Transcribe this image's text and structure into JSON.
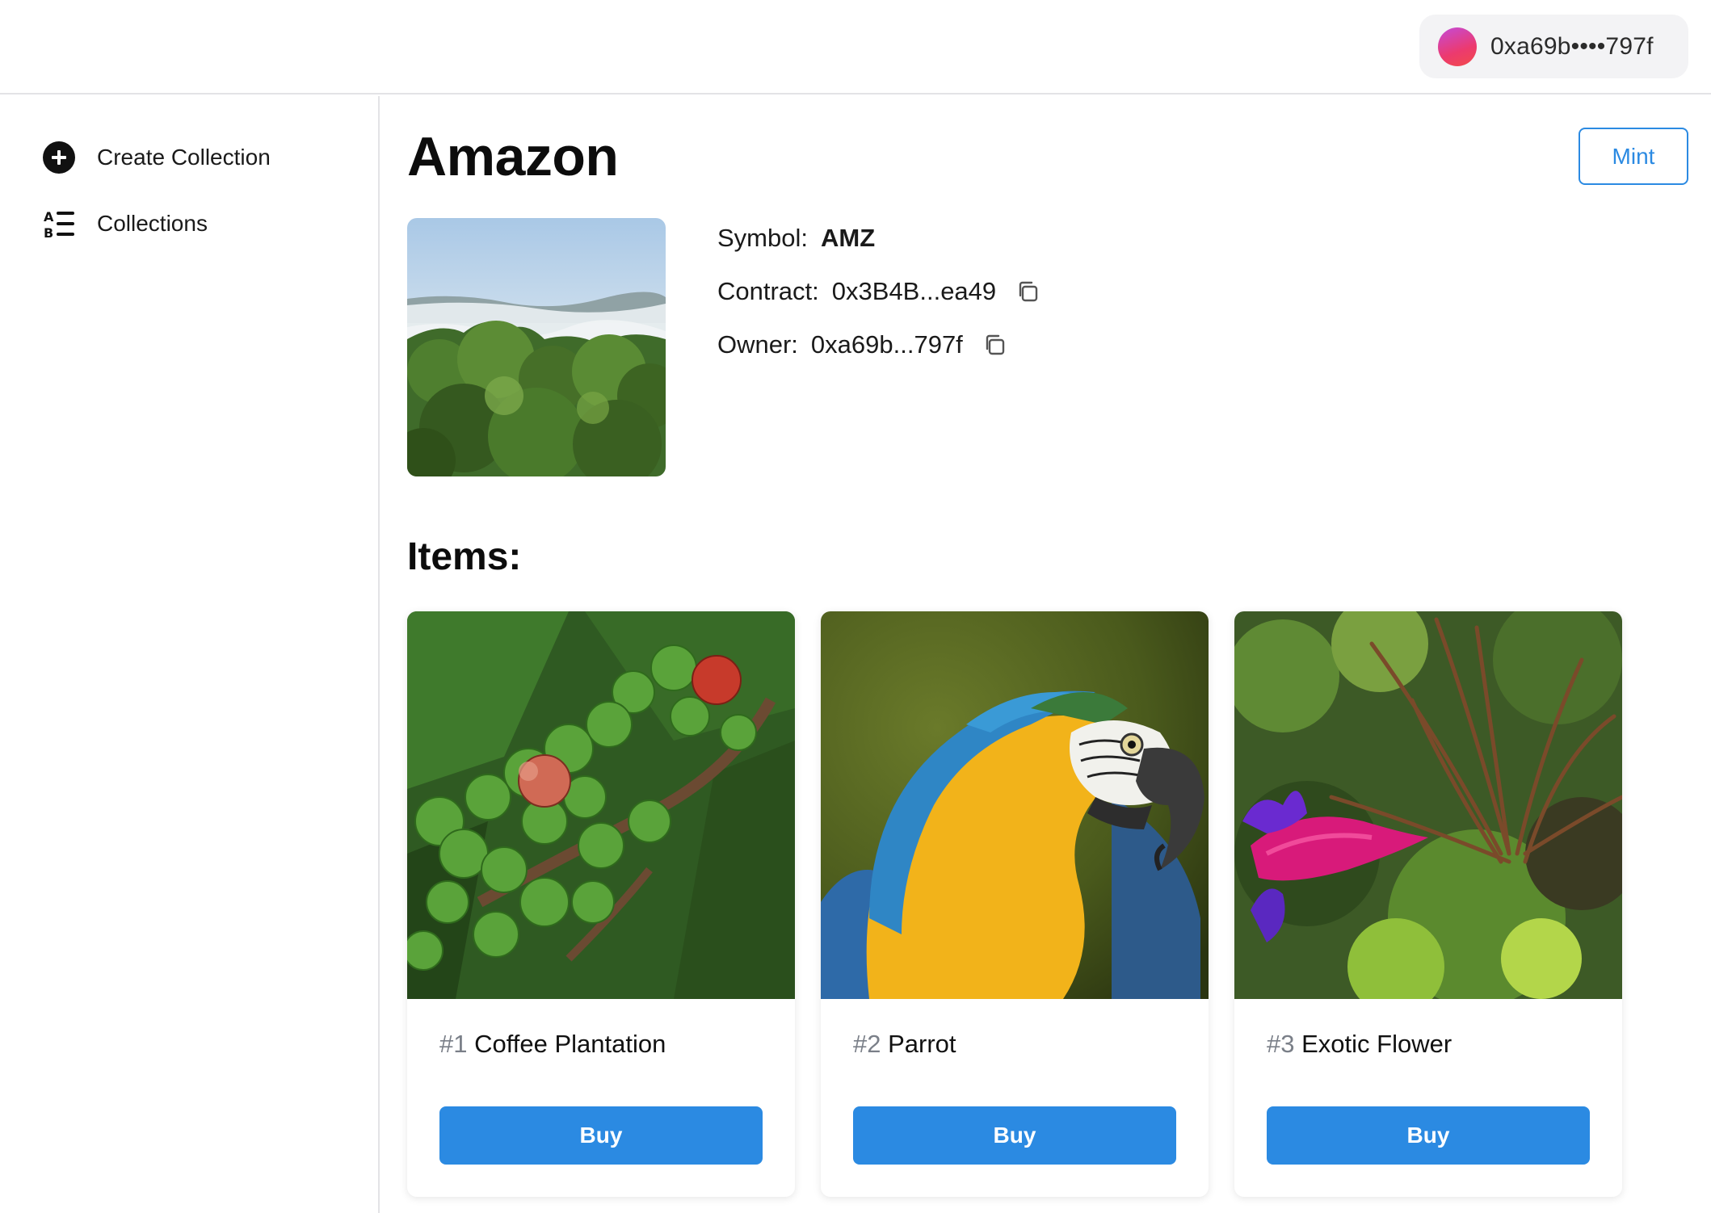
{
  "header": {
    "wallet_address": "0xa69b••••797f",
    "wallet_avatar_gradient": [
      "#c44bd8",
      "#ec3a6e",
      "#f24a4a"
    ]
  },
  "sidebar": {
    "items": [
      {
        "label": "Create Collection",
        "icon": "plus-circle-icon"
      },
      {
        "label": "Collections",
        "icon": "ab-list-icon"
      }
    ]
  },
  "collection": {
    "name": "Amazon",
    "mint_label": "Mint",
    "symbol_label": "Symbol:",
    "symbol": "AMZ",
    "contract_label": "Contract:",
    "contract": "0x3B4B...ea49",
    "owner_label": "Owner:",
    "owner": "0xa69b...797f",
    "cover_image": "misty-rainforest-landscape"
  },
  "items_heading": "Items:",
  "items": [
    {
      "number": "#1",
      "name": "Coffee Plantation",
      "buy_label": "Buy",
      "image": "coffee-berries"
    },
    {
      "number": "#2",
      "name": "Parrot",
      "buy_label": "Buy",
      "image": "blue-yellow-macaw"
    },
    {
      "number": "#3",
      "name": "Exotic Flower",
      "buy_label": "Buy",
      "image": "pink-bromeliad"
    }
  ],
  "colors": {
    "accent": "#2b8ae2",
    "border": "#e3e3e6",
    "muted_text": "#7a7f88"
  }
}
